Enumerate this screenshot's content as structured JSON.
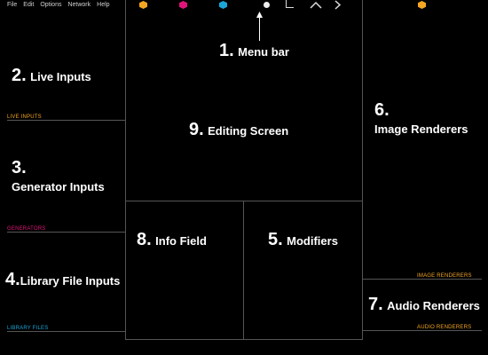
{
  "menu": [
    "File",
    "Edit",
    "Options",
    "Network",
    "Help"
  ],
  "toolbar": {
    "hex_colors": [
      "#f5a623",
      "#e0147a",
      "#1ca6d8"
    ],
    "tools": [
      "dot-tool",
      "corner-tool",
      "caret-up-tool",
      "caret-right-tool"
    ],
    "right_hex_color": "#f5a623"
  },
  "callouts": {
    "menu_bar": {
      "num": "1.",
      "label": "Menu bar"
    },
    "live_inputs": {
      "num": "2.",
      "label": "Live Inputs"
    },
    "generator_inputs": {
      "num": "3.",
      "label": "Generator Inputs"
    },
    "library_inputs": {
      "num": "4.",
      "label": "Library File Inputs"
    },
    "modifiers": {
      "num": "5.",
      "label": "Modifiers"
    },
    "image_renderers": {
      "num": "6.",
      "label": "Image Renderers"
    },
    "audio_renderers": {
      "num": "7.",
      "label": "Audio Renderers"
    },
    "info_field": {
      "num": "8.",
      "label": "Info Field"
    },
    "editing_screen": {
      "num": "9.",
      "label": "Editing Screen"
    }
  },
  "section_labels": {
    "live_inputs": "LIVE INPUTS",
    "generators": "GENERATORS",
    "library_files": "LIBRARY FILES",
    "image_renderers": "IMAGE RENDERERS",
    "audio_renderers": "AUDIO RENDERERS"
  },
  "colors": {
    "orange": "#f5a623",
    "magenta": "#e0147a",
    "cyan": "#1ca6d8"
  }
}
